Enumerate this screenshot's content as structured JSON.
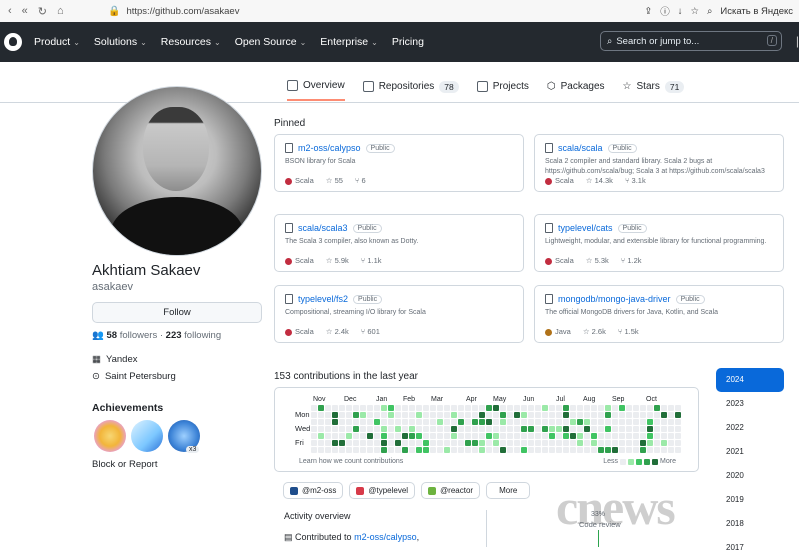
{
  "browser": {
    "url": "https://github.com/asakaev",
    "nav_buttons": [
      "‹",
      "«",
      "↻",
      "⌂"
    ],
    "right_text": "Искать в Яндекс"
  },
  "header": {
    "nav": [
      "Product",
      "Solutions",
      "Resources",
      "Open Source",
      "Enterprise",
      "Pricing"
    ],
    "search_placeholder": "Search or jump to...",
    "search_key": "/"
  },
  "tabs": [
    {
      "label": "Overview",
      "count": ""
    },
    {
      "label": "Repositories",
      "count": "78"
    },
    {
      "label": "Projects",
      "count": ""
    },
    {
      "label": "Packages",
      "count": ""
    },
    {
      "label": "Stars",
      "count": "71"
    }
  ],
  "profile": {
    "name": "Akhtiam Sakaev",
    "login": "asakaev",
    "follow_label": "Follow",
    "followers": "58",
    "followers_label": "followers",
    "following": "223",
    "following_label": "following",
    "company": "Yandex",
    "location": "Saint Petersburg",
    "achievements_title": "Achievements",
    "achievement_count": "x3",
    "block_report": "Block or Report"
  },
  "pinned": {
    "title": "Pinned",
    "cards": [
      {
        "repo": "m2-oss/calypso",
        "visibility": "Public",
        "desc": "BSON library for Scala",
        "lang": "Scala",
        "lang_color": "#c22d40",
        "stars": "55",
        "forks": "6"
      },
      {
        "repo": "scala/scala",
        "visibility": "Public",
        "desc": "Scala 2 compiler and standard library. Scala 2 bugs at https://github.com/scala/bug; Scala 3 at https://github.com/scala/scala3",
        "lang": "Scala",
        "lang_color": "#c22d40",
        "stars": "14.3k",
        "forks": "3.1k"
      },
      {
        "repo": "scala/scala3",
        "visibility": "Public",
        "desc": "The Scala 3 compiler, also known as Dotty.",
        "lang": "Scala",
        "lang_color": "#c22d40",
        "stars": "5.9k",
        "forks": "1.1k"
      },
      {
        "repo": "typelevel/cats",
        "visibility": "Public",
        "desc": "Lightweight, modular, and extensible library for functional programming.",
        "lang": "Scala",
        "lang_color": "#c22d40",
        "stars": "5.3k",
        "forks": "1.2k"
      },
      {
        "repo": "typelevel/fs2",
        "visibility": "Public",
        "desc": "Compositional, streaming I/O library for Scala",
        "lang": "Scala",
        "lang_color": "#c22d40",
        "stars": "2.4k",
        "forks": "601"
      },
      {
        "repo": "mongodb/mongo-java-driver",
        "visibility": "Public",
        "desc": "The official MongoDB drivers for Java, Kotlin, and Scala",
        "lang": "Java",
        "lang_color": "#b07219",
        "stars": "2.6k",
        "forks": "1.5k"
      }
    ]
  },
  "contributions": {
    "title": "153 contributions in the last year",
    "months": [
      "Nov",
      "Dec",
      "Jan",
      "Feb",
      "Mar",
      "Apr",
      "May",
      "Jun",
      "Jul",
      "Aug",
      "Sep",
      "Oct"
    ],
    "days": [
      "Mon",
      "Wed",
      "Fri"
    ],
    "learn": "Learn how we count contributions",
    "less": "Less",
    "more": "More",
    "colors": [
      "#ebedf0",
      "#9be9a8",
      "#40c463",
      "#30a14e",
      "#216e39"
    ]
  },
  "years": [
    "2024",
    "2023",
    "2022",
    "2021",
    "2020",
    "2019",
    "2018",
    "2017"
  ],
  "orgs": [
    {
      "name": "@m2-oss",
      "color": "#1f4e8c"
    },
    {
      "name": "@typelevel",
      "color": "#d73a49"
    },
    {
      "name": "@reactor",
      "color": "#6db33f"
    }
  ],
  "orgs_more": "More",
  "activity": {
    "title": "Activity overview",
    "contributed_prefix": "Contributed to",
    "contributed_repo": "m2-oss/calypso",
    "review_pct": "33%",
    "review_label": "Code review"
  },
  "watermark": "cnews"
}
